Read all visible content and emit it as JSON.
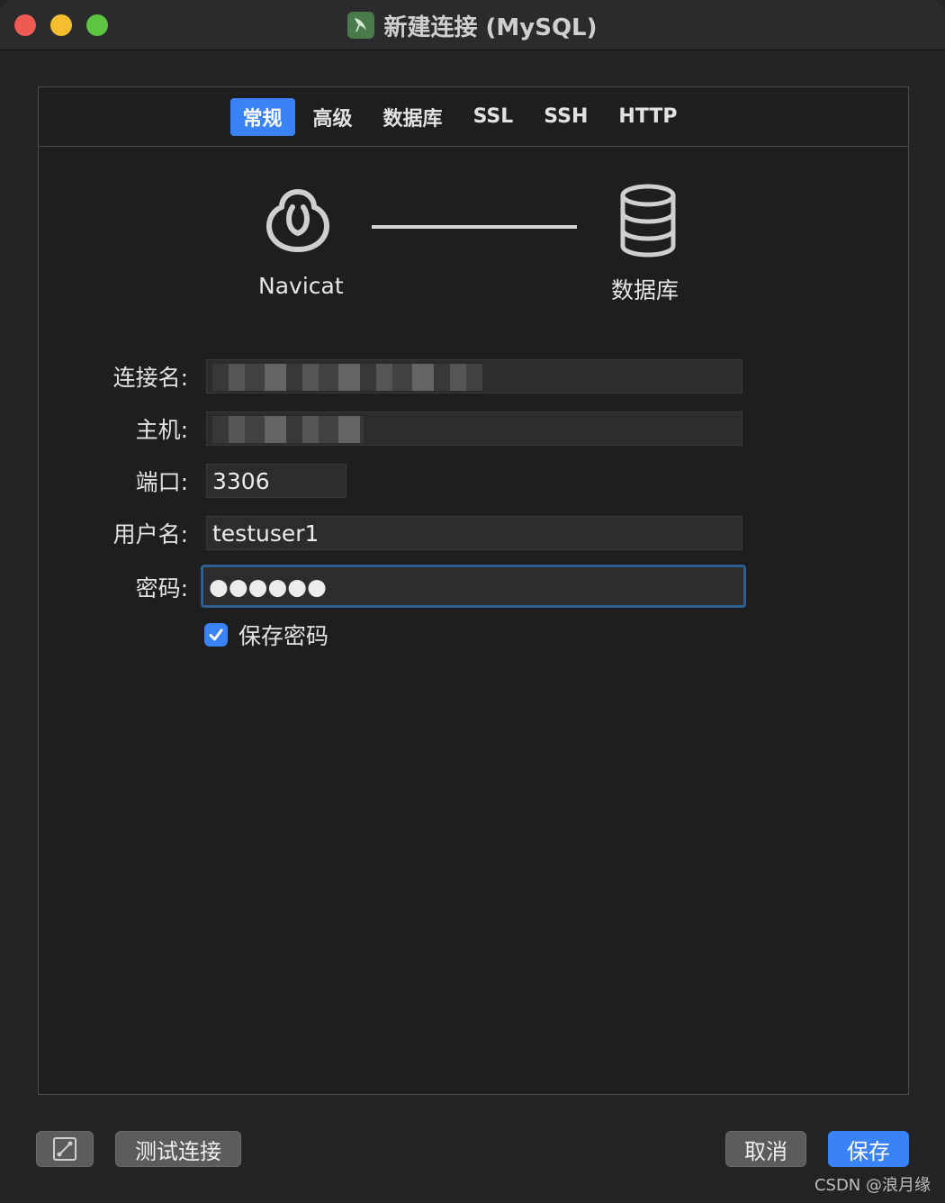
{
  "window": {
    "title": "新建连接 (MySQL)",
    "app_icon": "mysql-dolphin-icon"
  },
  "tabs": [
    {
      "label": "常规",
      "active": true
    },
    {
      "label": "高级",
      "active": false
    },
    {
      "label": "数据库",
      "active": false
    },
    {
      "label": "SSL",
      "active": false
    },
    {
      "label": "SSH",
      "active": false
    },
    {
      "label": "HTTP",
      "active": false
    }
  ],
  "diagram": {
    "left_label": "Navicat",
    "right_label": "数据库",
    "left_icon": "navicat-logo-icon",
    "right_icon": "database-icon"
  },
  "form": {
    "connection_name": {
      "label": "连接名:",
      "value": ""
    },
    "host": {
      "label": "主机:",
      "value": ""
    },
    "port": {
      "label": "端口:",
      "value": "3306"
    },
    "username": {
      "label": "用户名:",
      "value": "testuser1"
    },
    "password": {
      "label": "密码:",
      "value": "●●●●●●"
    },
    "save_password": {
      "label": "保存密码",
      "checked": true
    }
  },
  "buttons": {
    "test_connection": "测试连接",
    "cancel": "取消",
    "save": "保存",
    "settings_icon": "connection-settings-icon"
  },
  "watermark": "CSDN @浪月缘",
  "colors": {
    "accent": "#3a82f7",
    "background": "#1e1e1e",
    "titlebar": "#2b2b2d"
  }
}
